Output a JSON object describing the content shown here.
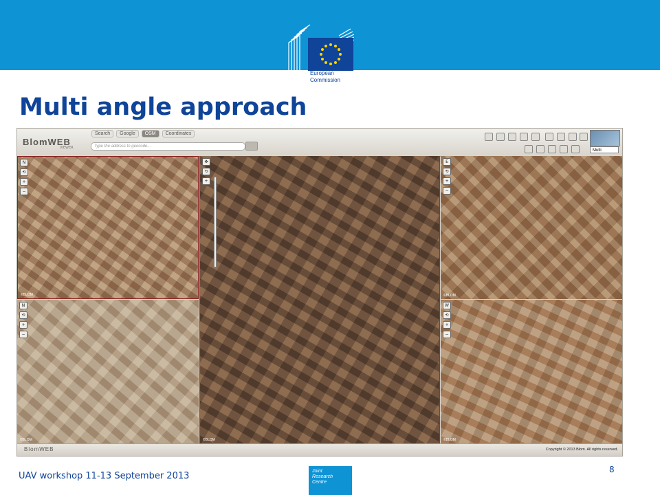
{
  "slide": {
    "title": "Multi angle approach",
    "footer": "UAV workshop 11-13 September 2013",
    "page_number": "8"
  },
  "logo": {
    "line1": "European",
    "line2": "Commission"
  },
  "jrc": {
    "line1": "Joint",
    "line2": "Research",
    "line3": "Centre"
  },
  "viewer": {
    "brand": "BlomWEB",
    "brand_sub": "VIEWER",
    "search_tabs": [
      "Search",
      "Google",
      "OSM",
      "Coordinates"
    ],
    "search_placeholder": "Type the address to geocode...",
    "view_mode": "Multi",
    "copyright": "Copyright © 2013 Blom. All rights reserved.",
    "pane_watermark": "©BLOM"
  },
  "colors": {
    "banner": "#0e93d5",
    "title": "#0f4499"
  }
}
